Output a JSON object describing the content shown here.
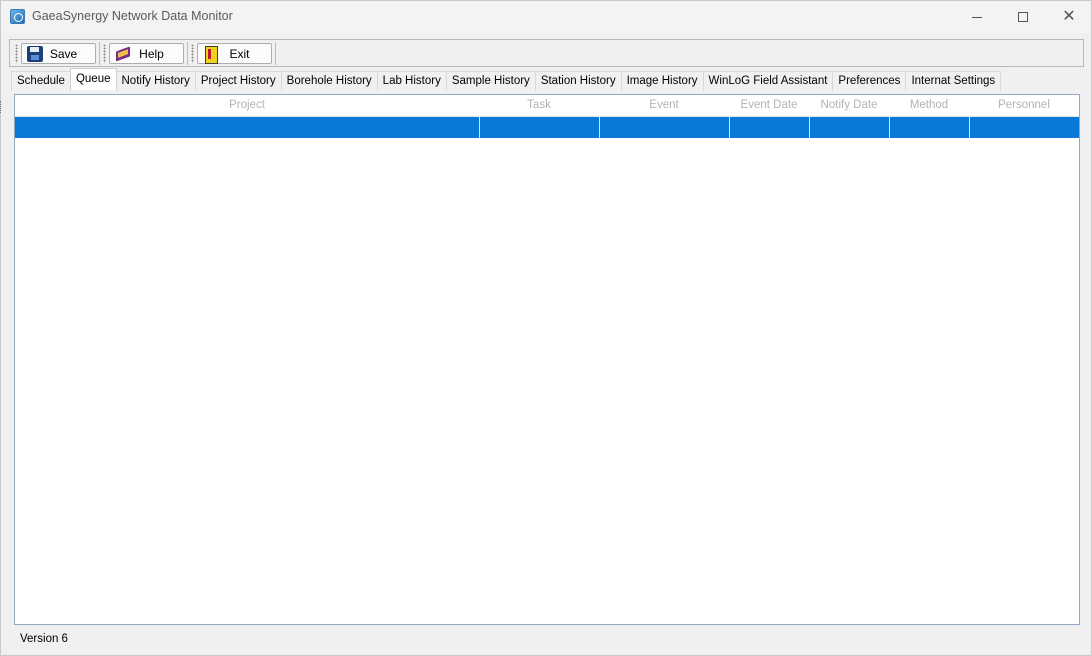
{
  "window": {
    "title": "GaeaSynergy Network Data Monitor"
  },
  "toolbar": {
    "save_label": "Save",
    "help_label": "Help",
    "exit_label": "Exit"
  },
  "tabs": [
    {
      "label": "Schedule",
      "active": false
    },
    {
      "label": "Queue",
      "active": true
    },
    {
      "label": "Notify History",
      "active": false
    },
    {
      "label": "Project History",
      "active": false
    },
    {
      "label": "Borehole History",
      "active": false
    },
    {
      "label": "Lab History",
      "active": false
    },
    {
      "label": "Sample History",
      "active": false
    },
    {
      "label": "Station History",
      "active": false
    },
    {
      "label": "Image History",
      "active": false
    },
    {
      "label": "WinLoG Field Assistant",
      "active": false
    },
    {
      "label": "Preferences",
      "active": false
    },
    {
      "label": "Internat Settings",
      "active": false
    }
  ],
  "grid": {
    "columns": [
      "Project",
      "Task",
      "Event",
      "Event Date",
      "Notify Date",
      "Method",
      "Personnel"
    ],
    "selected_row_color": "#0a78d6"
  },
  "status": {
    "version": "Version 6"
  },
  "icons": {
    "app": "app-icon",
    "save": "floppy-disk-icon",
    "help": "help-book-icon",
    "exit": "exit-door-icon"
  }
}
